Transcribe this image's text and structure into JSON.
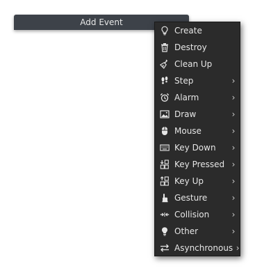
{
  "button": {
    "label": "Add Event"
  },
  "menu": {
    "items": [
      {
        "label": "Create",
        "icon": "bulb-outline-icon",
        "submenu": false
      },
      {
        "label": "Destroy",
        "icon": "trash-icon",
        "submenu": false
      },
      {
        "label": "Clean Up",
        "icon": "broom-icon",
        "submenu": false
      },
      {
        "label": "Step",
        "icon": "footsteps-icon",
        "submenu": true,
        "chevron": "›"
      },
      {
        "label": "Alarm",
        "icon": "alarm-clock-icon",
        "submenu": true,
        "chevron": "›"
      },
      {
        "label": "Draw",
        "icon": "picture-icon",
        "submenu": true,
        "chevron": "›"
      },
      {
        "label": "Mouse",
        "icon": "mouse-icon",
        "submenu": true,
        "chevron": "›"
      },
      {
        "label": "Key Down",
        "icon": "keyboard-icon",
        "submenu": true,
        "chevron": "›"
      },
      {
        "label": "Key Pressed",
        "icon": "key-pressed-icon",
        "submenu": true,
        "chevron": "›"
      },
      {
        "label": "Key Up",
        "icon": "key-up-icon",
        "submenu": true,
        "chevron": "›"
      },
      {
        "label": "Gesture",
        "icon": "hand-gesture-icon",
        "submenu": true,
        "chevron": "›"
      },
      {
        "label": "Collision",
        "icon": "collision-icon",
        "submenu": true,
        "chevron": "›"
      },
      {
        "label": "Other",
        "icon": "bulb-filled-icon",
        "submenu": true,
        "chevron": "›"
      },
      {
        "label": "Asynchronous",
        "icon": "swap-arrows-icon",
        "submenu": true,
        "chevron": "›"
      }
    ]
  }
}
